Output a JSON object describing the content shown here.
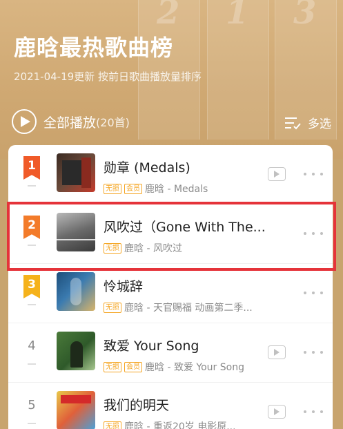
{
  "header": {
    "title": "鹿晗最热歌曲榜",
    "subtitle": "2021-04-19更新 按前日歌曲播放量排序",
    "deco_numbers": [
      "2",
      "1",
      "3"
    ]
  },
  "toolbar": {
    "play_all_label": "全部播放",
    "play_all_count": "(20首)",
    "multi_select_label": "多选"
  },
  "tag_labels": {
    "lossless": "无损",
    "vip": "会员"
  },
  "songs": [
    {
      "rank": "1",
      "title": "勋章 (Medals)",
      "tags": [
        "无损",
        "会员"
      ],
      "subtitle": "鹿晗 - Medals",
      "has_mv": true,
      "badge_color": "#f05a28"
    },
    {
      "rank": "2",
      "title": "风吹过（Gone With The...",
      "tags": [
        "无损"
      ],
      "subtitle": "鹿晗 - 风吹过",
      "has_mv": false,
      "badge_color": "#f37b2a"
    },
    {
      "rank": "3",
      "title": "怜城辞",
      "tags": [
        "无损"
      ],
      "subtitle": "鹿晗 - 天官赐福 动画第二季...",
      "has_mv": false,
      "badge_color": "#f5b21b"
    },
    {
      "rank": "4",
      "title": "致爱 Your Song",
      "tags": [
        "无损",
        "会员"
      ],
      "subtitle": "鹿晗 - 致爱 Your Song",
      "has_mv": true,
      "badge_color": ""
    },
    {
      "rank": "5",
      "title": "我们的明天",
      "tags": [
        "无损"
      ],
      "subtitle": "鹿晗 - 重返20岁 电影原...",
      "has_mv": true,
      "badge_color": ""
    }
  ],
  "colors": {
    "header_bg": "#cfa872",
    "accent_tag": "#f5a623",
    "highlight": "#e5333a"
  }
}
